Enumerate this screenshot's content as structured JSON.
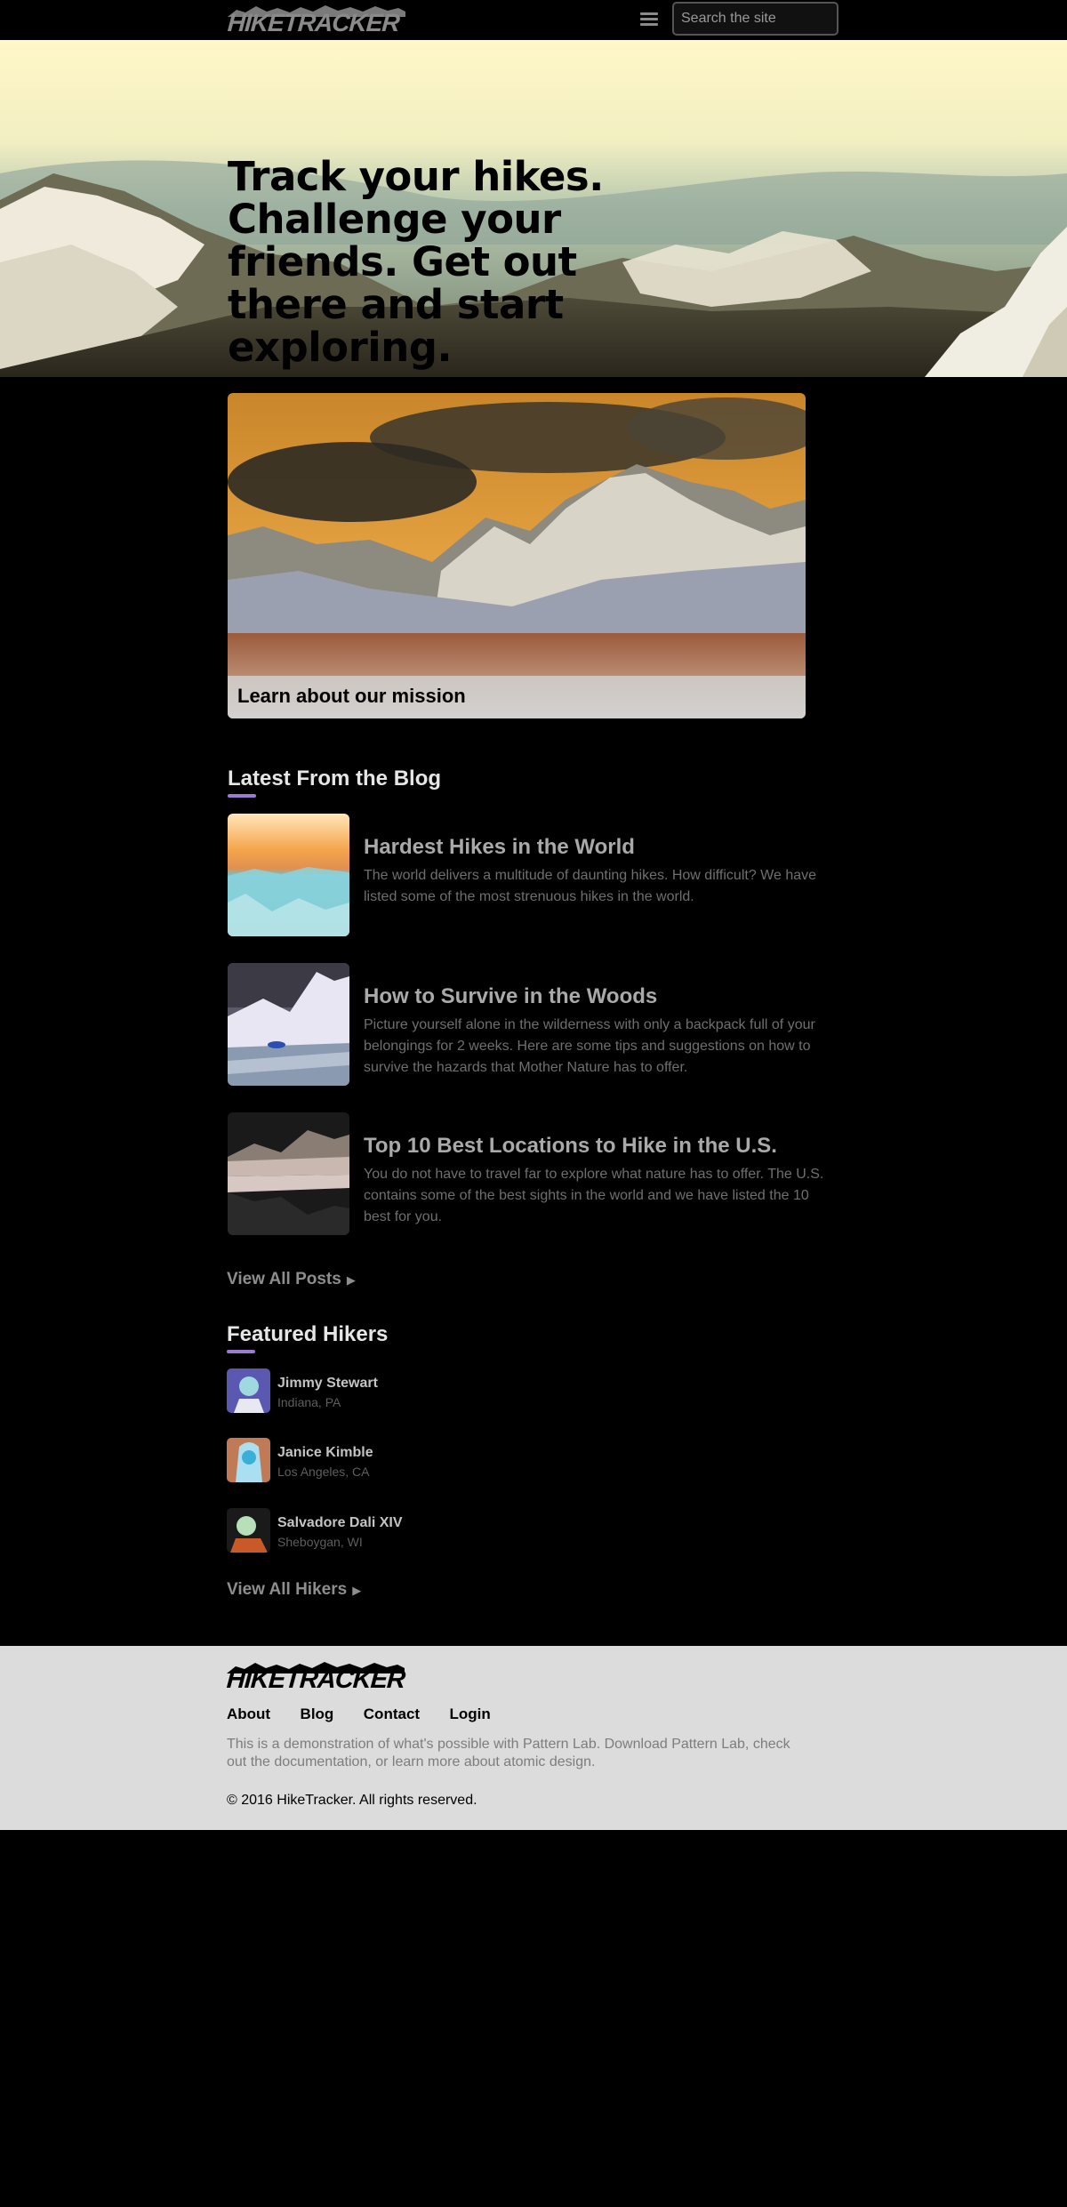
{
  "header": {
    "logo_text": "HIKETRACKER",
    "search_placeholder": "Search the site"
  },
  "hero": {
    "headline": "Track your hikes. Challenge your friends. Get out there and start exploring."
  },
  "feature": {
    "caption": "Learn about our mission"
  },
  "blog": {
    "title": "Latest From the Blog",
    "posts": [
      {
        "title": "Hardest Hikes in the World",
        "excerpt": "The world delivers a multitude of daunting hikes. How difficult? We have listed some of the most strenuous hikes in the world."
      },
      {
        "title": "How to Survive in the Woods",
        "excerpt": "Picture yourself alone in the wilderness with only a backpack full of your belongings for 2 weeks. Here are some tips and suggestions on how to survive the hazards that Mother Nature has to offer."
      },
      {
        "title": "Top 10 Best Locations to Hike in the U.S.",
        "excerpt": "You do not have to travel far to explore what nature has to offer. The U.S. contains some of the best sights in the world and we have listed the 10 best for you."
      }
    ],
    "view_all": "View All Posts"
  },
  "hikers": {
    "title": "Featured Hikers",
    "items": [
      {
        "name": "Jimmy Stewart",
        "location": "Indiana, PA"
      },
      {
        "name": "Janice Kimble",
        "location": "Los Angeles, CA"
      },
      {
        "name": "Salvadore Dali XIV",
        "location": "Sheboygan, WI"
      }
    ],
    "view_all": "View All Hikers"
  },
  "footer": {
    "logo_text": "HIKETRACKER",
    "nav": [
      "About",
      "Blog",
      "Contact",
      "Login"
    ],
    "description": "This is a demonstration of what's possible with Pattern Lab. Download Pattern Lab, check out the documentation, or learn more about atomic design.",
    "copyright": "© 2016 HikeTracker. All rights reserved."
  },
  "colors": {
    "accent_underline": "#9a7bd0",
    "background": "#000000",
    "footer_bg": "#dcdcdc"
  }
}
